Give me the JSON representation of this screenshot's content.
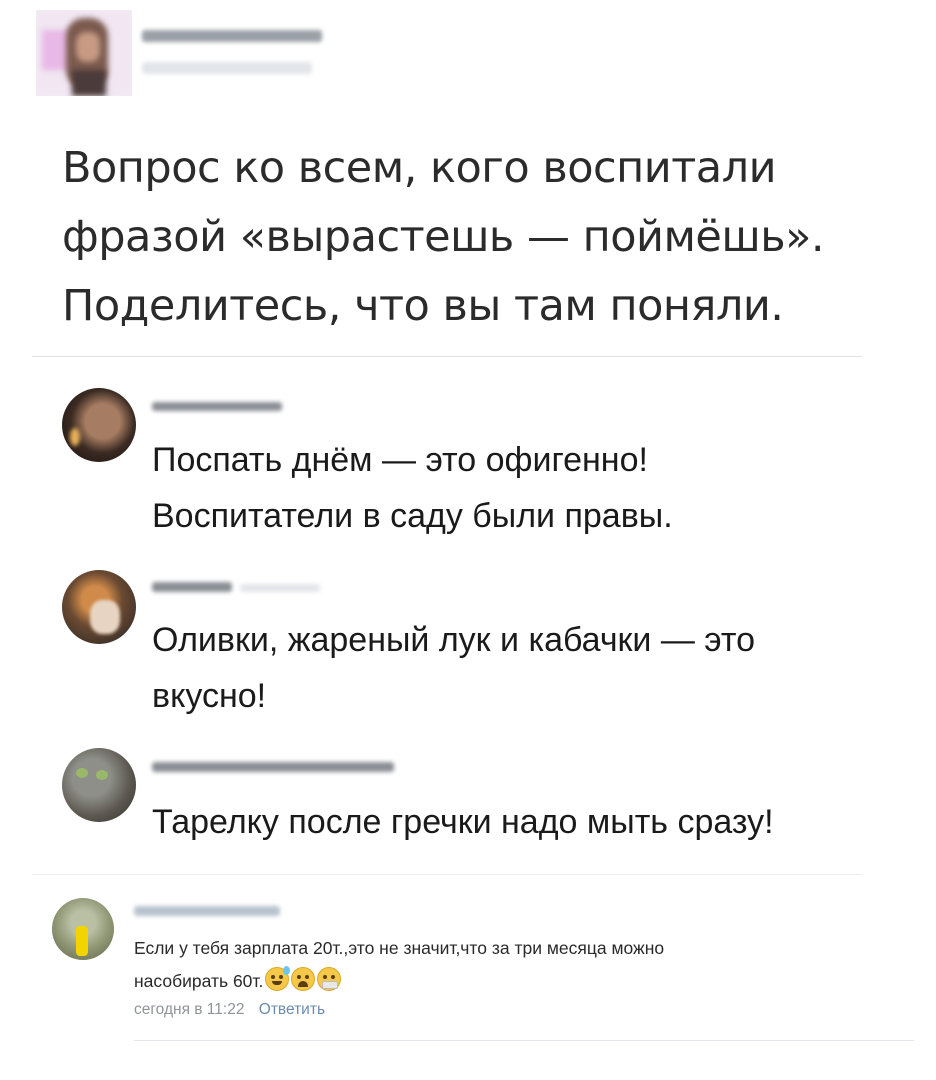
{
  "post": {
    "text_line1": "Вопрос ко всем, кого воспитали",
    "text_line2": "фразой «вырастешь — поймёшь».",
    "text_line3": "Поделитесь, что вы там поняли."
  },
  "comments": [
    {
      "text_line1": "Поспать днём — это офигенно!",
      "text_line2": "Воспитатели в саду были правы."
    },
    {
      "text_line1": "Оливки, жареный лук и кабачки — это",
      "text_line2": "вкусно!"
    },
    {
      "text_line1": "Тарелку после гречки надо мыть сразу!"
    }
  ],
  "vk_comment": {
    "text_line1": "Если у тебя зарплата 20т.,это не значит,что за три месяца можно",
    "text_line2": "насобирать 60т.",
    "emojis": [
      "sweat-smile-icon",
      "weary-face-icon",
      "sick-face-icon"
    ],
    "time": "сегодня в 11:22",
    "reply_label": "Ответить"
  },
  "colors": {
    "text": "#2b2b2b",
    "divider": "#e0e3e7",
    "meta": "#909499",
    "reply_link": "#6b8bb0"
  }
}
